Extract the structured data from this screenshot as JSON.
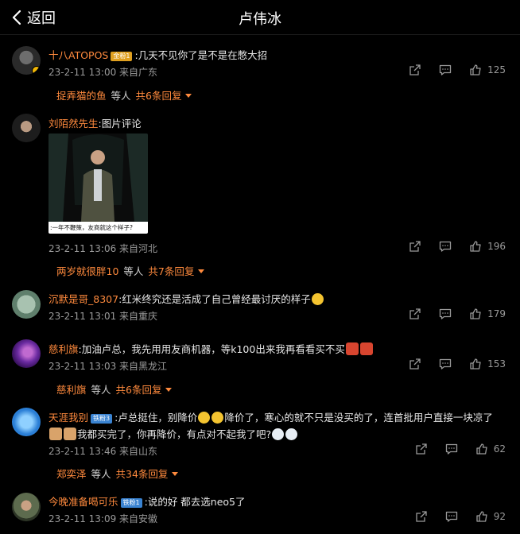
{
  "header": {
    "back_label": "返回",
    "title": "卢伟冰"
  },
  "comments": [
    {
      "user": "十八ATOPOS",
      "tag": "金粉1",
      "text": ":几天不见你了是不是在憋大招",
      "time": "23-2-11 13:00 来自广东",
      "likes": "125",
      "replies": {
        "name": "捉弄猫的鱼",
        "mid": "等人",
        "more": "共6条回复"
      }
    },
    {
      "user": "刘陌然先生",
      "text": ":图片评论",
      "image_caption": ":一年不鞭策，友商就这个样子?",
      "time": "23-2-11 13:06 来自河北",
      "likes": "196",
      "replies": {
        "name": "两岁就很胖10",
        "mid": "等人",
        "more": "共7条回复"
      }
    },
    {
      "user": "沉默是哥_8307",
      "text": ":红米终究还是活成了自己曾经最讨厌的样子",
      "time": "23-2-11 13:01 来自重庆",
      "likes": "179"
    },
    {
      "user": "慈利旗",
      "text": ":加油卢总，我先用用友商机器，等k100出来我再看看买不买",
      "time": "23-2-11 13:03 来自黑龙江",
      "likes": "153",
      "replies": {
        "name": "慈利旗",
        "mid": "等人",
        "more": "共6条回复"
      }
    },
    {
      "user": "天涯我别",
      "tag": "铁粉3",
      "text_a": ":卢总挺住，别降价",
      "text_b": "降价了，寒心的就不只是没买的了，连首批用户直接一块凉了",
      "text_c": "我都买完了，你再降价，有点对不起我了吧?",
      "time": "23-2-11 13:46 来自山东",
      "likes": "62",
      "replies": {
        "name": "郑奕泽",
        "mid": "等人",
        "more": "共34条回复"
      }
    },
    {
      "user": "今晚准备喝可乐",
      "tag": "铁粉1",
      "text": ":说的好 都去选neo5了",
      "time": "23-2-11 13:09 来自安徽",
      "likes": "92"
    }
  ],
  "icons": {
    "share": "share-icon",
    "comment": "comment-icon",
    "like": "thumbs-up-icon"
  },
  "colors": {
    "accent": "#ff8a3d",
    "background": "#000000",
    "muted": "#9a9a9a"
  }
}
